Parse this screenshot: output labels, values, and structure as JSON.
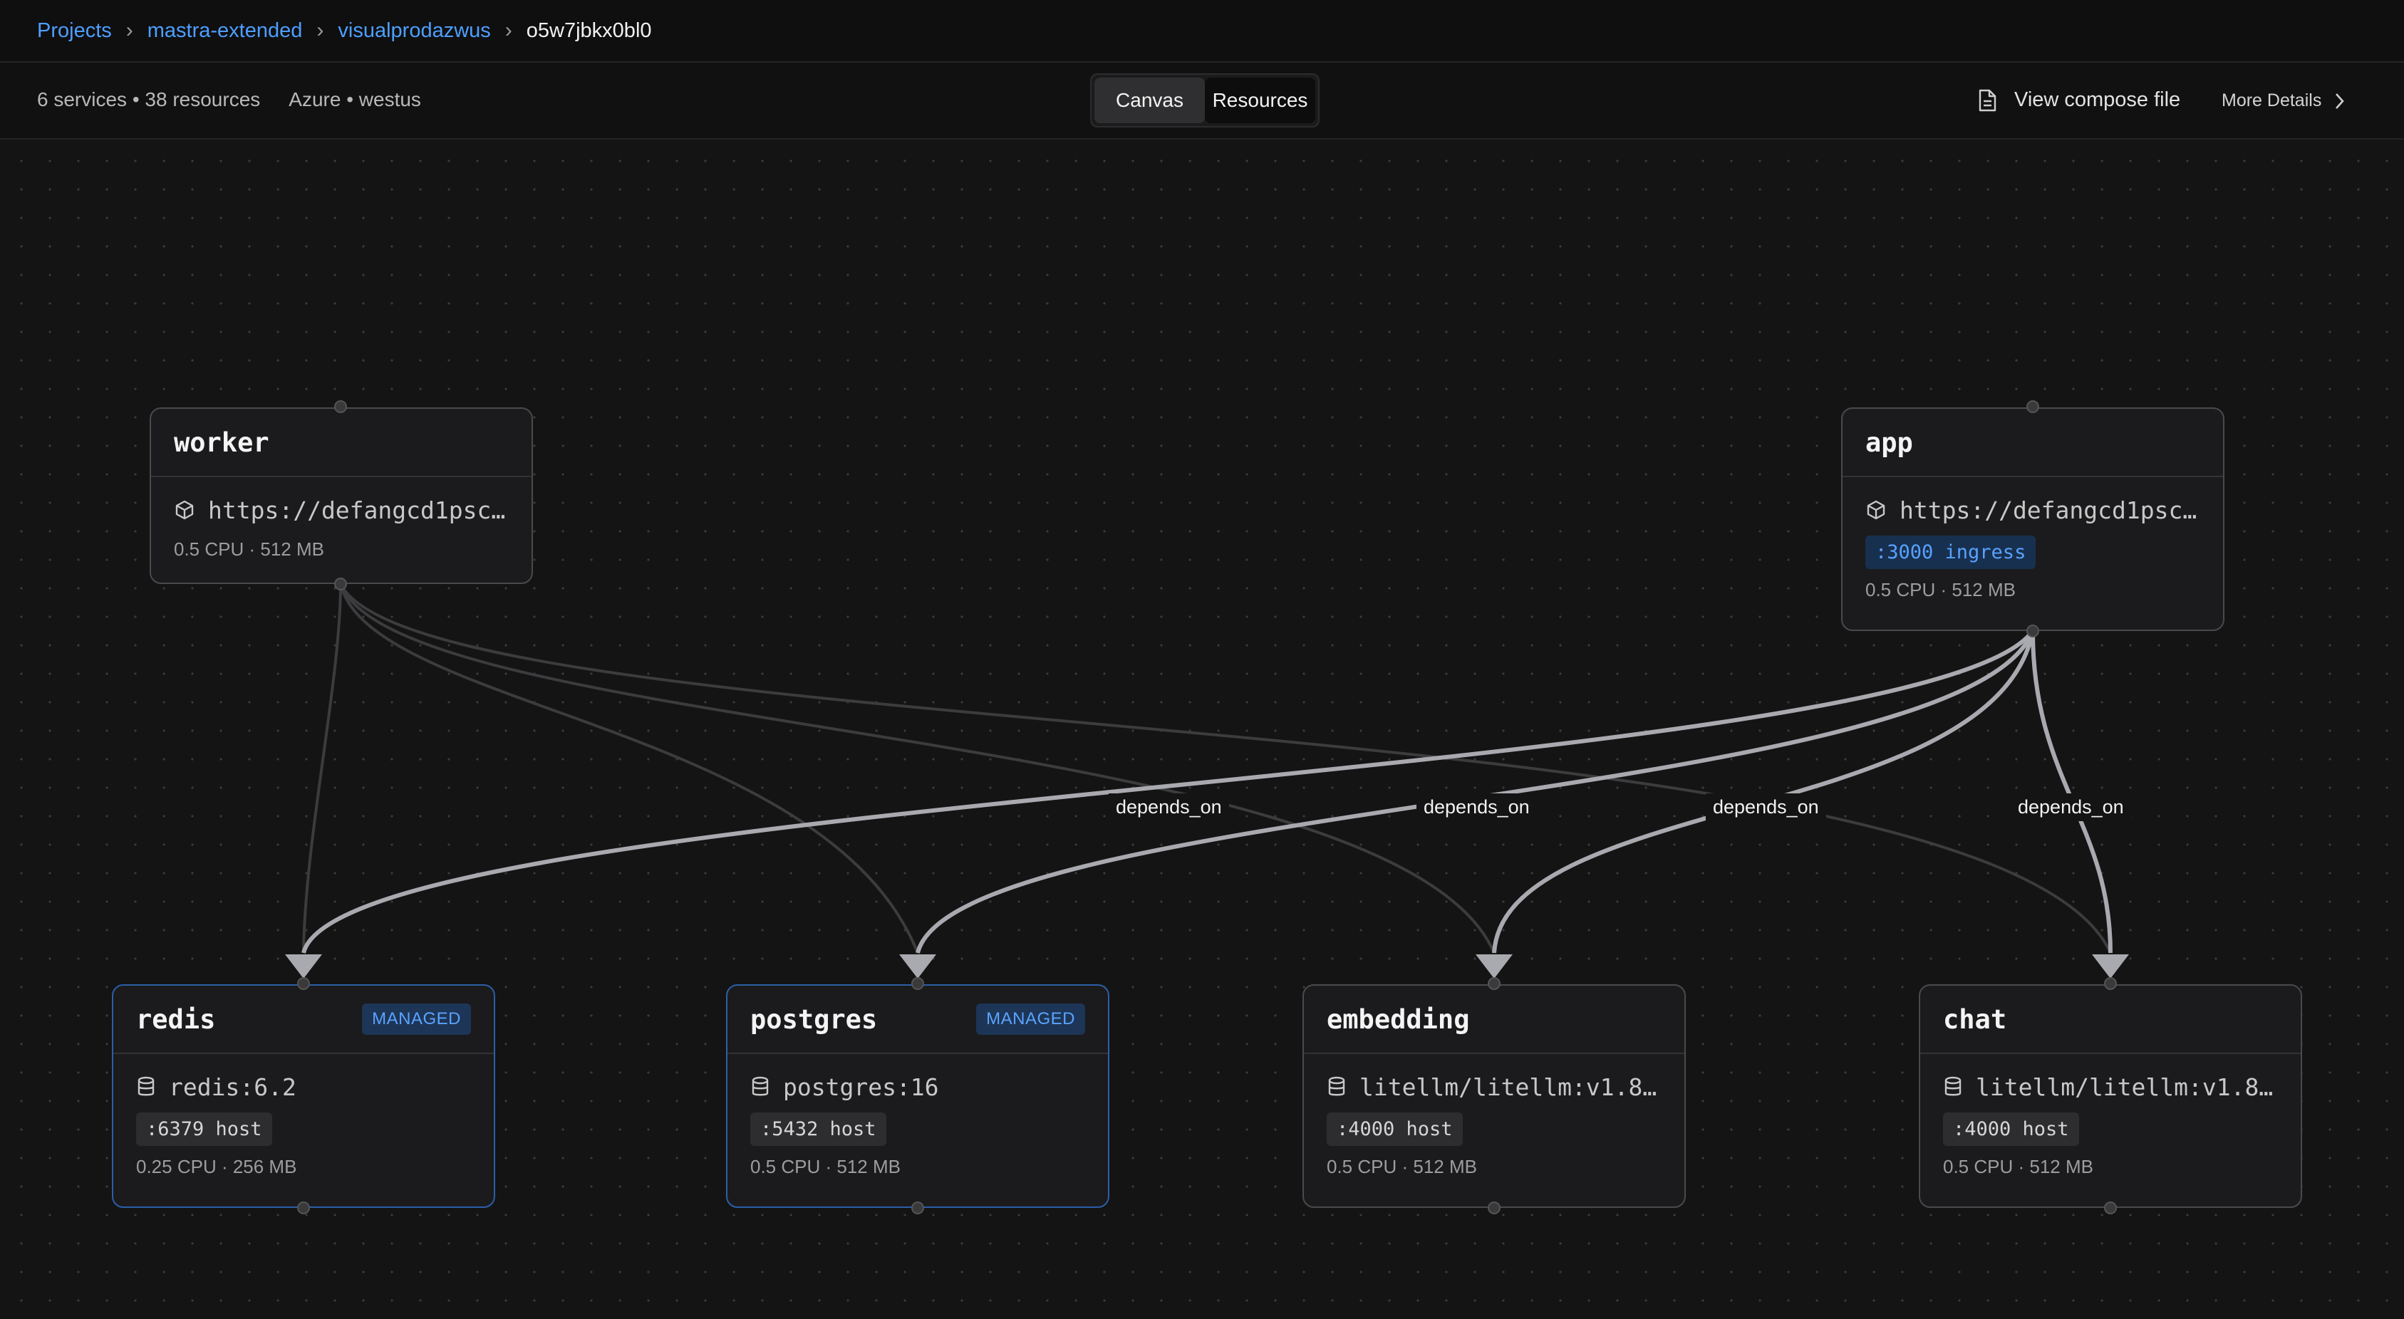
{
  "breadcrumb": {
    "items": [
      "Projects",
      "mastra-extended",
      "visualprodazwus"
    ],
    "current": "o5w7jbkx0bl0"
  },
  "summary": {
    "counts": "6 services • 38 resources",
    "region": "Azure • westus"
  },
  "tabs": {
    "canvas": "Canvas",
    "resources": "Resources",
    "active": "Canvas"
  },
  "actions": {
    "compose": "View compose file",
    "details": "More Details"
  },
  "services": {
    "worker": {
      "name": "worker",
      "url": "https://defangcd1psc…",
      "resources": "0.5 CPU · 512 MB"
    },
    "app": {
      "name": "app",
      "url": "https://defangcd1psc…",
      "port": ":3000 ingress",
      "resources": "0.5 CPU · 512 MB"
    },
    "redis": {
      "name": "redis",
      "badge": "MANAGED",
      "image": "redis:6.2",
      "port": ":6379 host",
      "resources": "0.25 CPU · 256 MB"
    },
    "postgres": {
      "name": "postgres",
      "badge": "MANAGED",
      "image": "postgres:16",
      "port": ":5432 host",
      "resources": "0.5 CPU · 512 MB"
    },
    "embedding": {
      "name": "embedding",
      "image": "litellm/litellm:v1.8…",
      "port": ":4000 host",
      "resources": "0.5 CPU · 512 MB"
    },
    "chat": {
      "name": "chat",
      "image": "litellm/litellm:v1.8…",
      "port": ":4000 host",
      "resources": "0.5 CPU · 512 MB"
    }
  },
  "edges": [
    {
      "from": "worker",
      "to": "redis"
    },
    {
      "from": "worker",
      "to": "postgres"
    },
    {
      "from": "worker",
      "to": "embedding"
    },
    {
      "from": "worker",
      "to": "chat"
    },
    {
      "from": "app",
      "to": "redis",
      "label": "depends_on"
    },
    {
      "from": "app",
      "to": "postgres",
      "label": "depends_on"
    },
    {
      "from": "app",
      "to": "embedding",
      "label": "depends_on"
    },
    {
      "from": "app",
      "to": "chat",
      "label": "depends_on"
    }
  ],
  "colors": {
    "accent": "#4d9fff",
    "managed_border": "#2b5fa8",
    "edge_primary": "#a9a9b0",
    "edge_secondary": "#3c3c3f"
  },
  "icons": {
    "service": "cube-icon",
    "image": "database-icon",
    "file": "file-icon",
    "chevron": "chevron-right-icon"
  }
}
